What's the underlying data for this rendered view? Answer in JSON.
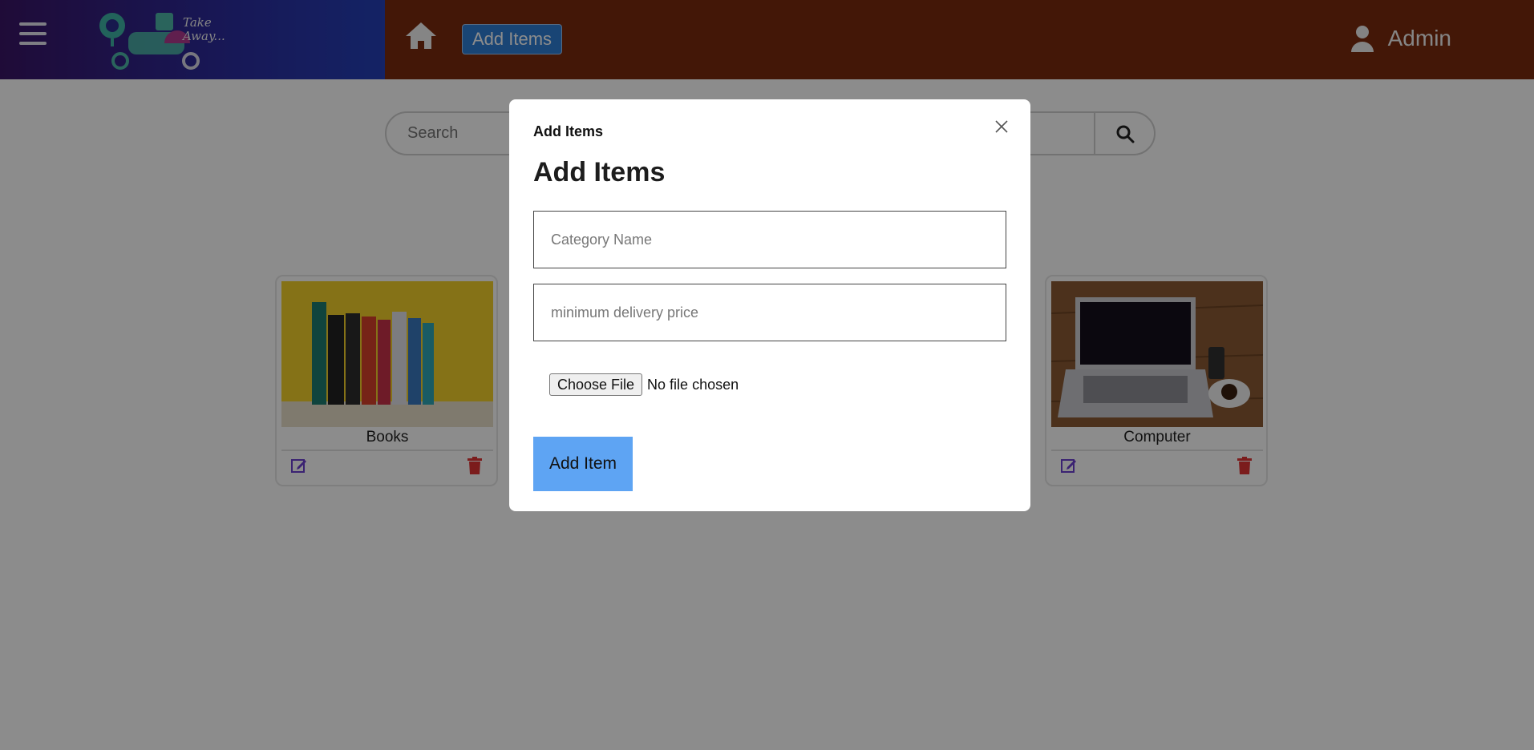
{
  "header": {
    "logo_text_line1": "Take",
    "logo_text_line2": "Away...",
    "nav_button_label": "Add Items",
    "user_name": "Admin"
  },
  "search": {
    "placeholder": "Search"
  },
  "cards": [
    {
      "title": "Books"
    },
    {
      "title": "Computer"
    }
  ],
  "modal": {
    "header": "Add Items",
    "title": "Add Items",
    "category_placeholder": "Category Name",
    "price_placeholder": "minimum delivery price",
    "file_button_label": "Choose File",
    "file_status": "No file chosen",
    "submit_label": "Add Item"
  },
  "colors": {
    "header_bg": "#7a2a0e",
    "brand_gradient_start": "#3a1566",
    "brand_gradient_end": "#2540b8",
    "nav_button_bg": "#2f7fd6",
    "submit_bg": "#5ea4f3",
    "edit_icon": "#6a3fd0",
    "trash_icon": "#e03333"
  },
  "icons": [
    "hamburger-icon",
    "home-icon",
    "user-icon",
    "search-icon",
    "edit-icon",
    "trash-icon",
    "close-icon"
  ]
}
